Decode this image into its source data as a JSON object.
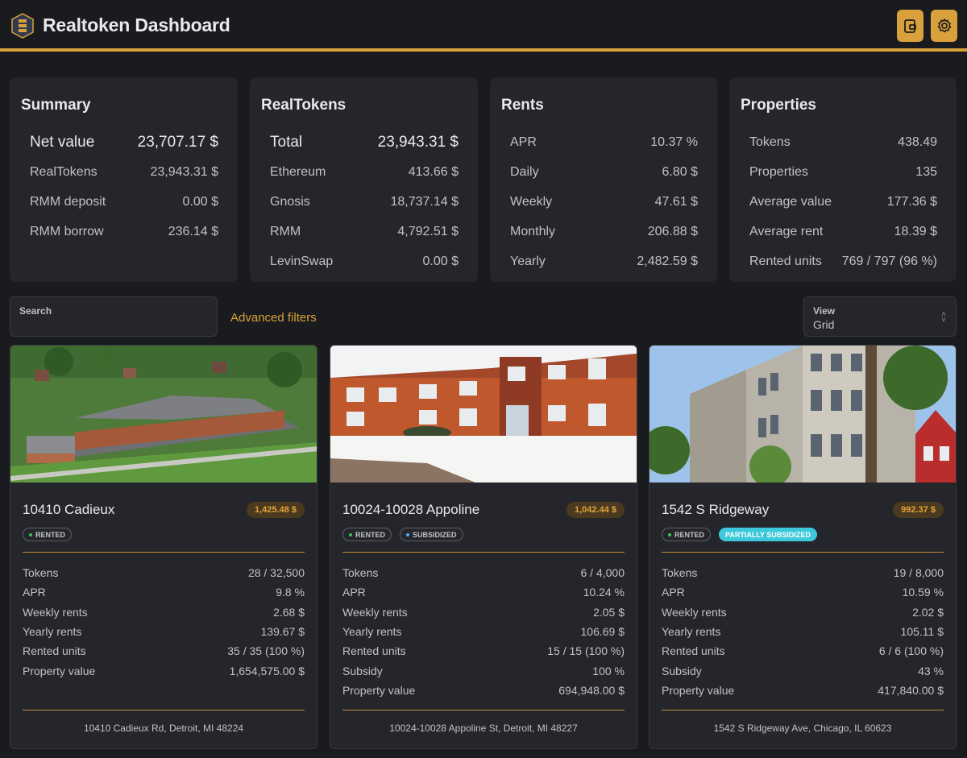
{
  "header": {
    "title": "Realtoken Dashboard",
    "accent": "#d9a13b"
  },
  "summary": {
    "title": "Summary",
    "rows": [
      {
        "label": "Net value",
        "value": "23,707.17 $"
      },
      {
        "label": "RealTokens",
        "value": "23,943.31 $"
      },
      {
        "label": "RMM deposit",
        "value": "0.00 $"
      },
      {
        "label": "RMM borrow",
        "value": "236.14 $"
      }
    ]
  },
  "realtokens": {
    "title": "RealTokens",
    "rows": [
      {
        "label": "Total",
        "value": "23,943.31 $"
      },
      {
        "label": "Ethereum",
        "value": "413.66 $"
      },
      {
        "label": "Gnosis",
        "value": "18,737.14 $"
      },
      {
        "label": "RMM",
        "value": "4,792.51 $"
      },
      {
        "label": "LevinSwap",
        "value": "0.00 $"
      }
    ]
  },
  "rents": {
    "title": "Rents",
    "rows": [
      {
        "label": "APR",
        "value": "10.37 %"
      },
      {
        "label": "Daily",
        "value": "6.80 $"
      },
      {
        "label": "Weekly",
        "value": "47.61 $"
      },
      {
        "label": "Monthly",
        "value": "206.88 $"
      },
      {
        "label": "Yearly",
        "value": "2,482.59 $"
      }
    ]
  },
  "properties": {
    "title": "Properties",
    "rows": [
      {
        "label": "Tokens",
        "value": "438.49"
      },
      {
        "label": "Properties",
        "value": "135"
      },
      {
        "label": "Average value",
        "value": "177.36 $"
      },
      {
        "label": "Average rent",
        "value": "18.39 $"
      },
      {
        "label": "Rented units",
        "value": "769 / 797 (96 %)"
      }
    ]
  },
  "filters": {
    "search_label": "Search",
    "search_value": "",
    "advanced": "Advanced filters",
    "view_label": "View",
    "view_value": "Grid"
  },
  "cards": [
    {
      "name": "10410 Cadieux",
      "price": "1,425.48 $",
      "badges": [
        "RENTED"
      ],
      "rows": [
        {
          "label": "Tokens",
          "value": "28 / 32,500"
        },
        {
          "label": "APR",
          "value": "9.8 %"
        },
        {
          "label": "Weekly rents",
          "value": "2.68 $"
        },
        {
          "label": "Yearly rents",
          "value": "139.67 $"
        },
        {
          "label": "Rented units",
          "value": "35 / 35 (100 %)"
        },
        {
          "label": "Property value",
          "value": "1,654,575.00 $"
        }
      ],
      "address": "10410 Cadieux Rd, Detroit, MI 48224"
    },
    {
      "name": "10024-10028 Appoline",
      "price": "1,042.44 $",
      "badges": [
        "RENTED",
        "SUBSIDIZED"
      ],
      "rows": [
        {
          "label": "Tokens",
          "value": "6 / 4,000"
        },
        {
          "label": "APR",
          "value": "10.24 %"
        },
        {
          "label": "Weekly rents",
          "value": "2.05 $"
        },
        {
          "label": "Yearly rents",
          "value": "106.69 $"
        },
        {
          "label": "Rented units",
          "value": "15 / 15 (100 %)"
        },
        {
          "label": "Subsidy",
          "value": "100 %"
        },
        {
          "label": "Property value",
          "value": "694,948.00 $"
        }
      ],
      "address": "10024-10028 Appoline St, Detroit, MI 48227"
    },
    {
      "name": "1542 S Ridgeway",
      "price": "992.37 $",
      "badges": [
        "RENTED",
        "PARTIALLY SUBSIDIZED"
      ],
      "rows": [
        {
          "label": "Tokens",
          "value": "19 / 8,000"
        },
        {
          "label": "APR",
          "value": "10.59 %"
        },
        {
          "label": "Weekly rents",
          "value": "2.02 $"
        },
        {
          "label": "Yearly rents",
          "value": "105.11 $"
        },
        {
          "label": "Rented units",
          "value": "6 / 6 (100 %)"
        },
        {
          "label": "Subsidy",
          "value": "43 %"
        },
        {
          "label": "Property value",
          "value": "417,840.00 $"
        }
      ],
      "address": "1542 S Ridgeway Ave, Chicago, IL 60623"
    }
  ]
}
